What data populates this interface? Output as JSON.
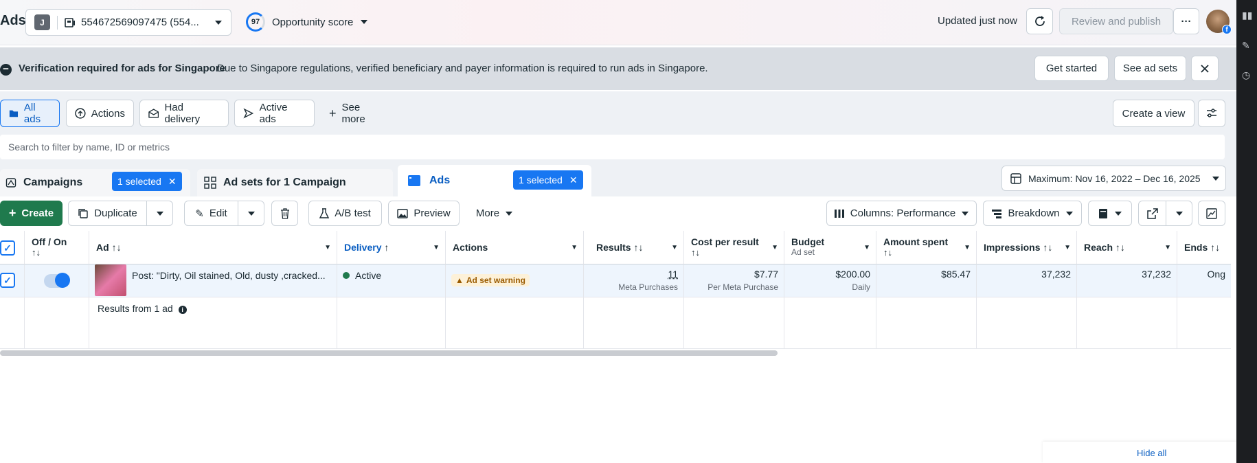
{
  "header": {
    "app_title": "Ads",
    "account_initial": "J",
    "account_name": "554672569097475 (554...",
    "opportunity_score": "97",
    "opportunity_label": "Opportunity score",
    "updated_text": "Updated just now",
    "review_publish_label": "Review and publish",
    "more_label": "···"
  },
  "banner": {
    "title": "Verification required for ads for Singapore",
    "message": "Due to Singapore regulations, verified beneficiary and payer information is required to run ads in Singapore.",
    "get_started_label": "Get started",
    "see_ad_sets_label": "See ad sets"
  },
  "filters": {
    "all_ads": "All ads",
    "actions": "Actions",
    "had_delivery": "Had delivery",
    "active_ads": "Active ads",
    "see_more": "See more",
    "create_view": "Create a view"
  },
  "search": {
    "placeholder": "Search to filter by name, ID or metrics"
  },
  "tabs": {
    "campaigns": "Campaigns",
    "campaigns_selected": "1 selected",
    "adsets": "Ad sets for 1 Campaign",
    "ads": "Ads",
    "ads_selected": "1 selected"
  },
  "date_range": "Maximum: Nov 16, 2022 – Dec 16, 2025",
  "toolbar": {
    "create": "Create",
    "duplicate": "Duplicate",
    "edit": "Edit",
    "ab_test": "A/B test",
    "preview": "Preview",
    "more": "More",
    "columns": "Columns: Performance",
    "breakdown": "Breakdown"
  },
  "table": {
    "headers": {
      "offon": "Off / On",
      "ad": "Ad",
      "delivery": "Delivery",
      "actions": "Actions",
      "results": "Results",
      "cost_per_result": "Cost per result",
      "budget": "Budget",
      "budget_sub": "Ad set",
      "amount_spent": "Amount spent",
      "impressions": "Impressions",
      "reach": "Reach",
      "ends": "Ends"
    },
    "row": {
      "ad_name": "Post: \"Dirty, Oil stained, Old, dusty ,cracked...",
      "delivery": "Active",
      "actions": "Ad set warning",
      "results": "11",
      "results_sub": "Meta Purchases",
      "cost_per_result": "$7.77",
      "cost_per_result_sub": "Per Meta Purchase",
      "budget": "$200.00",
      "budget_sub": "Daily",
      "amount_spent": "$85.47",
      "impressions": "37,232",
      "reach": "37,232",
      "ends": "Ong"
    },
    "summary": "Results from 1 ad"
  },
  "footer": {
    "hide_all": "Hide all"
  },
  "colors": {
    "accent": "#1877f2",
    "create_green": "#1f7a4d",
    "banner_bg": "#d9dde3"
  }
}
